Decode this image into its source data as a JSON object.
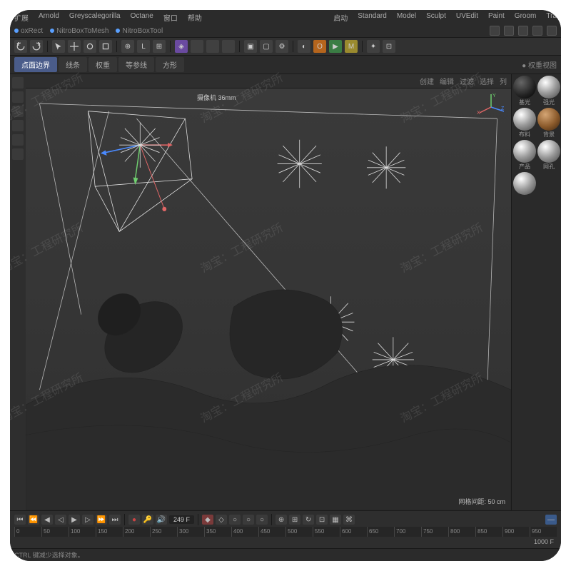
{
  "menubar": {
    "left": [
      "扩展",
      "Arnold",
      "Greyscalegorilla",
      "Octane",
      "窗口",
      "帮助"
    ],
    "right": [
      "启动",
      "Standard",
      "Model",
      "Sculpt",
      "UVEdit",
      "Paint",
      "Groom",
      "Tra"
    ]
  },
  "plugins": {
    "items": [
      "oxRect",
      "NitroBoxToMesh",
      "NitroBoxTool"
    ]
  },
  "mode_tabs": {
    "items": [
      "点面边界",
      "线条",
      "权重",
      "等参线",
      "方形"
    ],
    "active_index": 0,
    "right_label": "权重视图"
  },
  "viewport_header": {
    "right": [
      "创建",
      "编辑",
      "过滤",
      "选择",
      "列"
    ]
  },
  "viewport": {
    "camera_label": "摄像机 36mm",
    "grid_label": "网格间距: 50 cm",
    "axis_labels": {
      "x": "X",
      "y": "Y",
      "z": "Z"
    }
  },
  "materials": {
    "labels": [
      "基光",
      "强光",
      "布料",
      "背景",
      "产品",
      "网孔",
      ""
    ]
  },
  "timeline": {
    "current_frame": "249 F",
    "ticks": [
      "0",
      "50",
      "100",
      "150",
      "200",
      "250",
      "300",
      "350",
      "400",
      "450",
      "500",
      "550",
      "600",
      "650",
      "700",
      "750",
      "800",
      "850",
      "900",
      "950"
    ],
    "end_label": "1000 F"
  },
  "status": {
    "hint": "CTRL 键减少选择对象。"
  },
  "watermark_text": "淘宝：工程研究所",
  "colors": {
    "accent_blue": "#4a5c8a"
  }
}
